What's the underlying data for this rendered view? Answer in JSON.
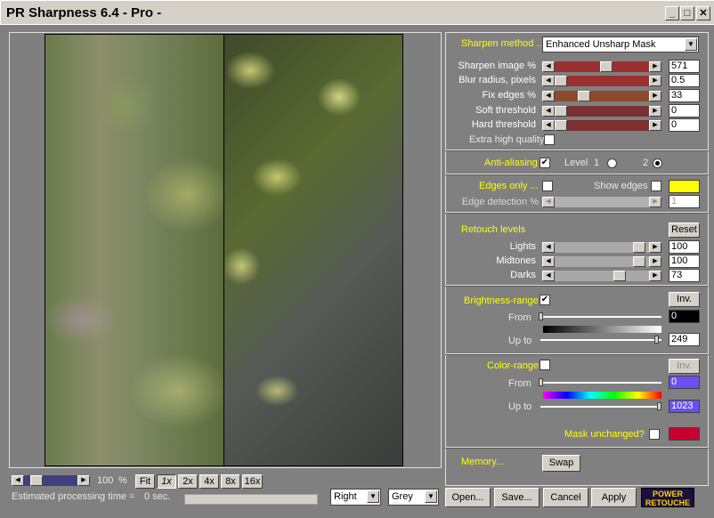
{
  "window": {
    "title": "PR Sharpness 6.4 - Pro -",
    "buttons": {
      "minimize": "_",
      "maximize": "□",
      "close": "✕"
    }
  },
  "sharpen": {
    "method_label": "Sharpen method ...",
    "method_value": "Enhanced Unsharp Mask",
    "rows": [
      {
        "label": "Sharpen image %",
        "value": "571",
        "level": 0.55,
        "color": "#9b3030"
      },
      {
        "label": "Blur radius, pixels",
        "value": "0.5",
        "level": 0.0,
        "color": "#9b3030"
      },
      {
        "label": "Fix edges %",
        "value": "33",
        "level": 0.28,
        "color": "#8b4a2a"
      },
      {
        "label": "Soft threshold",
        "value": "0",
        "level": 0.0,
        "color": "#7a3030"
      },
      {
        "label": "Hard threshold",
        "value": "0",
        "level": 0.0,
        "color": "#7a3030"
      }
    ],
    "extra_quality_label": "Extra high quality"
  },
  "antialias": {
    "label": "Anti-aliasing",
    "checked": "✔",
    "level_label": "Level",
    "level1": "1",
    "level2": "2"
  },
  "edges": {
    "only_label": "Edges only ...",
    "show_label": "Show edges",
    "detect_label": "Edge detection %",
    "detect_value": "1",
    "color": "#ffff00"
  },
  "retouch": {
    "label": "Retouch levels",
    "reset": "Reset",
    "rows": [
      {
        "label": "Lights",
        "value": "100",
        "level": 0.96
      },
      {
        "label": "Midtones",
        "value": "100",
        "level": 0.96
      },
      {
        "label": "Darks",
        "value": "73",
        "level": 0.72
      }
    ]
  },
  "brightness": {
    "label": "Brightness-range",
    "checked": "✔",
    "inv": "Inv.",
    "from_label": "From",
    "from_value": "0",
    "upto_label": "Up to",
    "upto_value": "249",
    "from_level": 0.0,
    "upto_level": 0.976
  },
  "colorrange": {
    "label": "Color-range",
    "inv": "Inv.",
    "from_label": "From",
    "from_value": "0",
    "upto_label": "Up to",
    "upto_value": "1023",
    "from_level": 0.0,
    "upto_level": 1.0,
    "value_color": "#6a50f0"
  },
  "mask": {
    "label": "Mask unchanged?",
    "color": "#c80030"
  },
  "memory": {
    "label": "Memory...",
    "swap": "Swap"
  },
  "bottom": {
    "zoom_value": "100",
    "zoom_unit": "%",
    "zoom_level": 0.15,
    "zoom_buttons": [
      "Fit",
      "1x",
      "2x",
      "4x",
      "8x",
      "16x"
    ],
    "est_time": "Estimated processing time =",
    "est_value": "0 sec.",
    "side": "Right",
    "mode": "Grey",
    "open": "Open...",
    "save": "Save...",
    "cancel": "Cancel",
    "apply": "Apply",
    "logo_top": "POWER",
    "logo_bottom": "RETOUCHE"
  }
}
